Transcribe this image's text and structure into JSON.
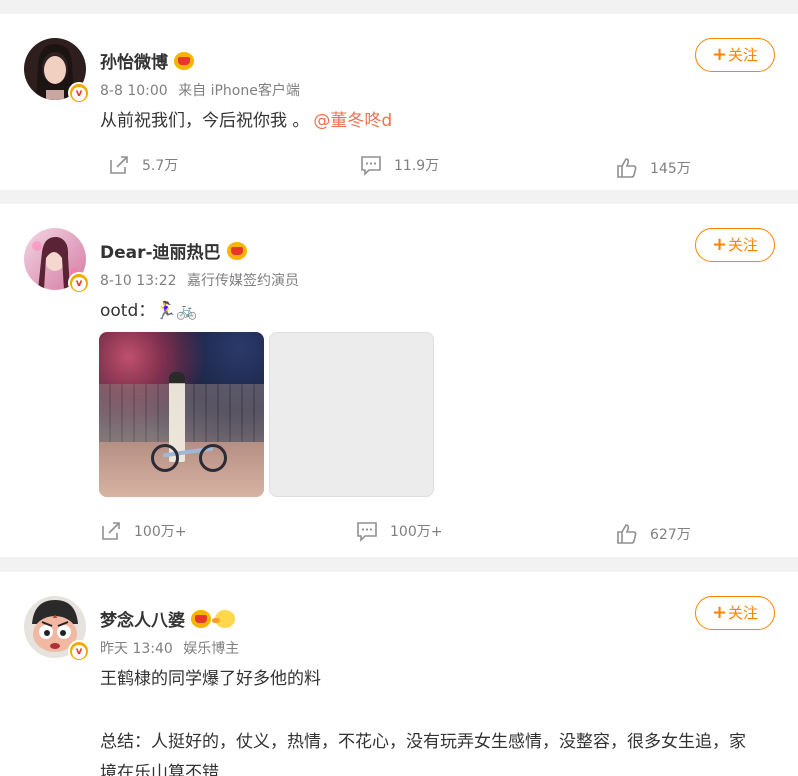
{
  "posts": [
    {
      "name": "孙怡微博",
      "time": "8-8 10:00",
      "source": "来自 iPhone客户端",
      "text": "从前祝我们，今后祝你我 。",
      "mention": "@董冬咚d",
      "follow_label": "关注",
      "follow_plus": "+",
      "reposts": "5.7万",
      "comments": "11.9万",
      "likes": "145万"
    },
    {
      "name": "Dear-迪丽热巴",
      "time": "8-10 13:22",
      "source": "嘉行传媒签约演员",
      "text": "ootd：🏃‍♀️🚲",
      "follow_label": "关注",
      "follow_plus": "+",
      "reposts": "100万+",
      "comments": "100万+",
      "likes": "627万"
    },
    {
      "name": "梦念人八婆",
      "time": "昨天 13:40",
      "source": "娱乐博主",
      "text": "王鹤棣的同学爆了好多他的料",
      "text2": "总结：人挺好的，仗义，热情，不花心，没有玩弄女生感情，没整容，很多女生追，家",
      "text3": "境在乐山算不错",
      "follow_label": "关注",
      "follow_plus": "+"
    }
  ],
  "colors": {
    "accent": "#ff8200",
    "mention": "#eb7350",
    "muted": "#808080"
  },
  "icons": [
    "repost-icon",
    "comment-icon",
    "like-icon",
    "verified-badge-icon",
    "crown-icon",
    "duck-icon"
  ]
}
